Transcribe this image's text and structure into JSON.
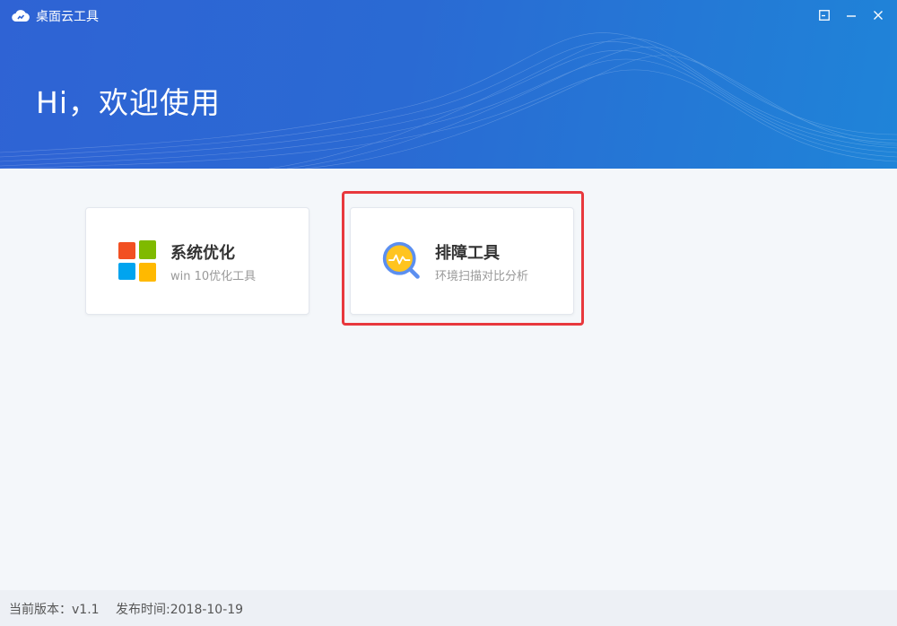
{
  "app": {
    "title": "桌面云工具",
    "greeting": "Hi，欢迎使用"
  },
  "window_controls": {
    "icons": [
      "restore-icon",
      "minimize-icon",
      "close-icon"
    ]
  },
  "cards": [
    {
      "title": "系统优化",
      "subtitle": "win 10优化工具",
      "icon": "windows-logo-icon"
    },
    {
      "title": "排障工具",
      "subtitle": "环境扫描对比分析",
      "icon": "magnifier-chart-icon",
      "highlighted": true
    }
  ],
  "footer": {
    "version": "当前版本：v1.1",
    "release": "发布时间:2018-10-19"
  },
  "colors": {
    "header_start": "#2f63d4",
    "header_end": "#1f84d8",
    "highlight": "#e8383d",
    "win_red": "#f25022",
    "win_green": "#7fba00",
    "win_blue": "#00a4ef",
    "win_yellow": "#ffb900"
  }
}
